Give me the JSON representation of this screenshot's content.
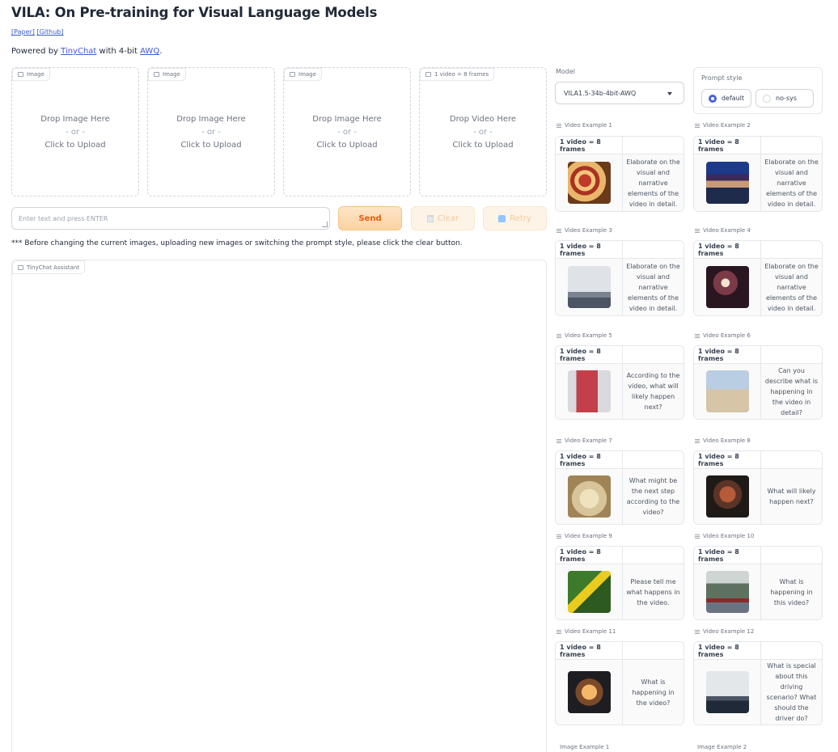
{
  "header": {
    "title": "VILA: On Pre-training for Visual Language Models",
    "links": [
      "[Paper]",
      "[Github]"
    ],
    "powered_prefix": "Powered by ",
    "powered_tinychat": "TinyChat",
    "powered_mid": " with 4-bit ",
    "powered_awq": "AWQ",
    "powered_suffix": "."
  },
  "uploads": [
    {
      "label": "Image",
      "line1": "Drop Image Here",
      "line2": "- or -",
      "line3": "Click to Upload"
    },
    {
      "label": "Image",
      "line1": "Drop Image Here",
      "line2": "- or -",
      "line3": "Click to Upload"
    },
    {
      "label": "Image",
      "line1": "Drop Image Here",
      "line2": "- or -",
      "line3": "Click to Upload"
    },
    {
      "label": "1 video = 8 frames",
      "line1": "Drop Video Here",
      "line2": "- or -",
      "line3": "Click to Upload"
    }
  ],
  "input": {
    "placeholder": "Enter text and press ENTER"
  },
  "buttons": {
    "send": "Send",
    "clear": "Clear",
    "retry": "Retry"
  },
  "note": "*** Before changing the current images, uploading new images or switching the prompt style, please click the clear button.",
  "chat": {
    "label": "TinyChat Assistant"
  },
  "model": {
    "label": "Model",
    "value": "VILA1.5-34b-4bit-AWQ"
  },
  "prompt_style": {
    "label": "Prompt style",
    "options": [
      "default",
      "no-sys"
    ],
    "selected": "default"
  },
  "examples": [
    {
      "label": "Video Example 1",
      "header": "1 video = 8 frames",
      "thumb": "pizza",
      "text": "Elaborate on the visual and narrative elements of the video in detail."
    },
    {
      "label": "Video Example 2",
      "header": "1 video = 8 frames",
      "thumb": "man",
      "text": "Elaborate on the visual and narrative elements of the video in detail."
    },
    {
      "label": "Video Example 3",
      "header": "1 video = 8 frames",
      "thumb": "city",
      "text": "Elaborate on the visual and narrative elements of the video in detail."
    },
    {
      "label": "Video Example 4",
      "header": "1 video = 8 frames",
      "thumb": "dark",
      "text": "Elaborate on the visual and narrative elements of the video in detail."
    },
    {
      "label": "Video Example 5",
      "header": "1 video = 8 frames",
      "thumb": "blend",
      "text": "According to the video, what will likely happen next?"
    },
    {
      "label": "Video Example 6",
      "header": "1 video = 8 frames",
      "thumb": "desert",
      "text": "Can you describe what is happening in the video in detail?"
    },
    {
      "label": "Video Example 7",
      "header": "1 video = 8 frames",
      "thumb": "dough",
      "text": "What might be the next step according to the video?"
    },
    {
      "label": "Video Example 8",
      "header": "1 video = 8 frames",
      "thumb": "bowl",
      "text": "What will likely happen next?"
    },
    {
      "label": "Video Example 9",
      "header": "1 video = 8 frames",
      "thumb": "field",
      "text": "Please tell me what happens in the video."
    },
    {
      "label": "Video Example 10",
      "header": "1 video = 8 frames",
      "thumb": "rain",
      "text": "What is happening in this video?"
    },
    {
      "label": "Video Example 11",
      "header": "1 video = 8 frames",
      "thumb": "mirror",
      "text": "What is happening in the video?"
    },
    {
      "label": "Video Example 12",
      "header": "1 video = 8 frames",
      "thumb": "fog",
      "text": "What is special about this driving scenario? What should the driver do?"
    }
  ],
  "image_examples": [
    {
      "label": "Image Example 1"
    },
    {
      "label": "Image Example 2"
    }
  ]
}
